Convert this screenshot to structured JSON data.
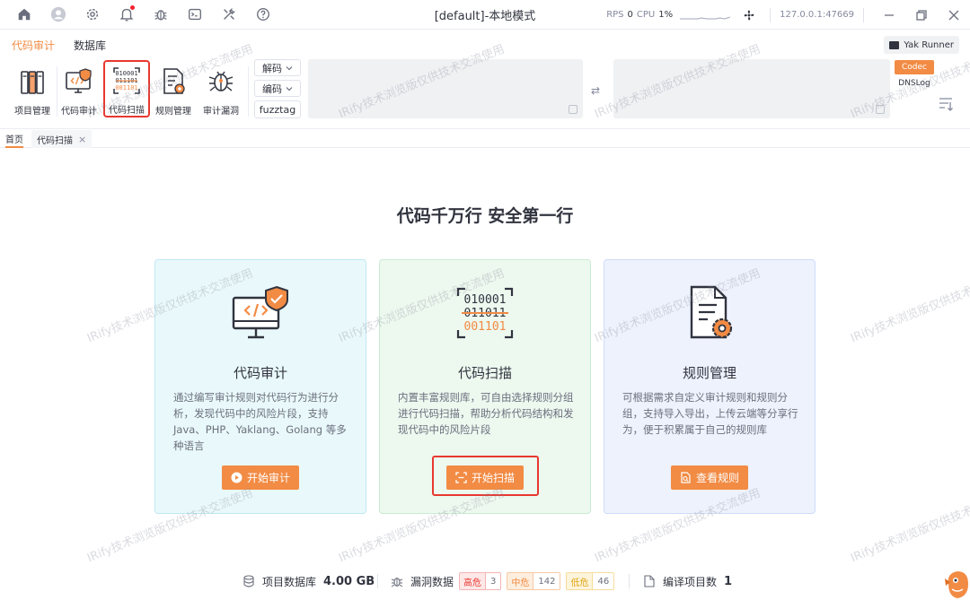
{
  "window": {
    "title": "[default]-本地模式"
  },
  "titlebar": {
    "rps_label": "RPS",
    "rps_value": "0",
    "cpu_label": "CPU",
    "cpu_value": "1%",
    "address": "127.0.0.1:47669"
  },
  "menu": {
    "tabs": [
      "代码审计",
      "数据库"
    ],
    "active": 0,
    "yak_runner": "Yak Runner"
  },
  "toolbar": {
    "items": [
      {
        "label": "项目管理",
        "icon": "project-manage-icon"
      },
      {
        "label": "代码审计",
        "icon": "code-audit-icon"
      },
      {
        "label": "代码扫描",
        "icon": "code-scan-icon"
      },
      {
        "label": "规则管理",
        "icon": "rule-manage-icon"
      },
      {
        "label": "审计漏洞",
        "icon": "audit-vuln-icon"
      }
    ],
    "decode_label": "解码",
    "encode_label": "编码",
    "fuzztag_label": "fuzztag",
    "codec_label": "Codec",
    "dnslog_label": "DNSLog"
  },
  "page_tabs": [
    {
      "label": "首页"
    },
    {
      "label": "代码扫描"
    }
  ],
  "headline": "代码千万行 安全第一行",
  "cards": [
    {
      "title": "代码审计",
      "description": "通过编写审计规则对代码行为进行分析，发现代码中的风险片段，支持 Java、PHP、Yaklang、Golang 等多种语言",
      "button": "开始审计",
      "bg": "#e9f9fb",
      "border": "#bfe8f1"
    },
    {
      "title": "代码扫描",
      "description": "内置丰富规则库，可自由选择规则分组进行代码扫描，帮助分析代码结构和发现代码中的风险片段",
      "button": "开始扫描",
      "bg": "#edf8ef",
      "border": "#c9ecd2"
    },
    {
      "title": "规则管理",
      "description": "可根据需求自定义审计规则和规则分组，支持导入导出，上传云端等分享行为，便于积累属于自己的规则库",
      "button": "查看规则",
      "bg": "#edf2fd",
      "border": "#cfdcf7"
    }
  ],
  "footer": {
    "db_label": "项目数据库",
    "db_value": "4.00 GB",
    "vuln_label": "漏洞数据",
    "high_label": "高危",
    "high_count": "3",
    "mid_label": "中危",
    "mid_count": "142",
    "low_label": "低危",
    "low_count": "46",
    "compile_label": "编译项目数",
    "compile_value": "1"
  },
  "watermark": "IRify技术浏览版仅供技术交流使用",
  "colors": {
    "accent": "#f28b44",
    "highlight": "#e8382f",
    "text": "#31343f"
  }
}
